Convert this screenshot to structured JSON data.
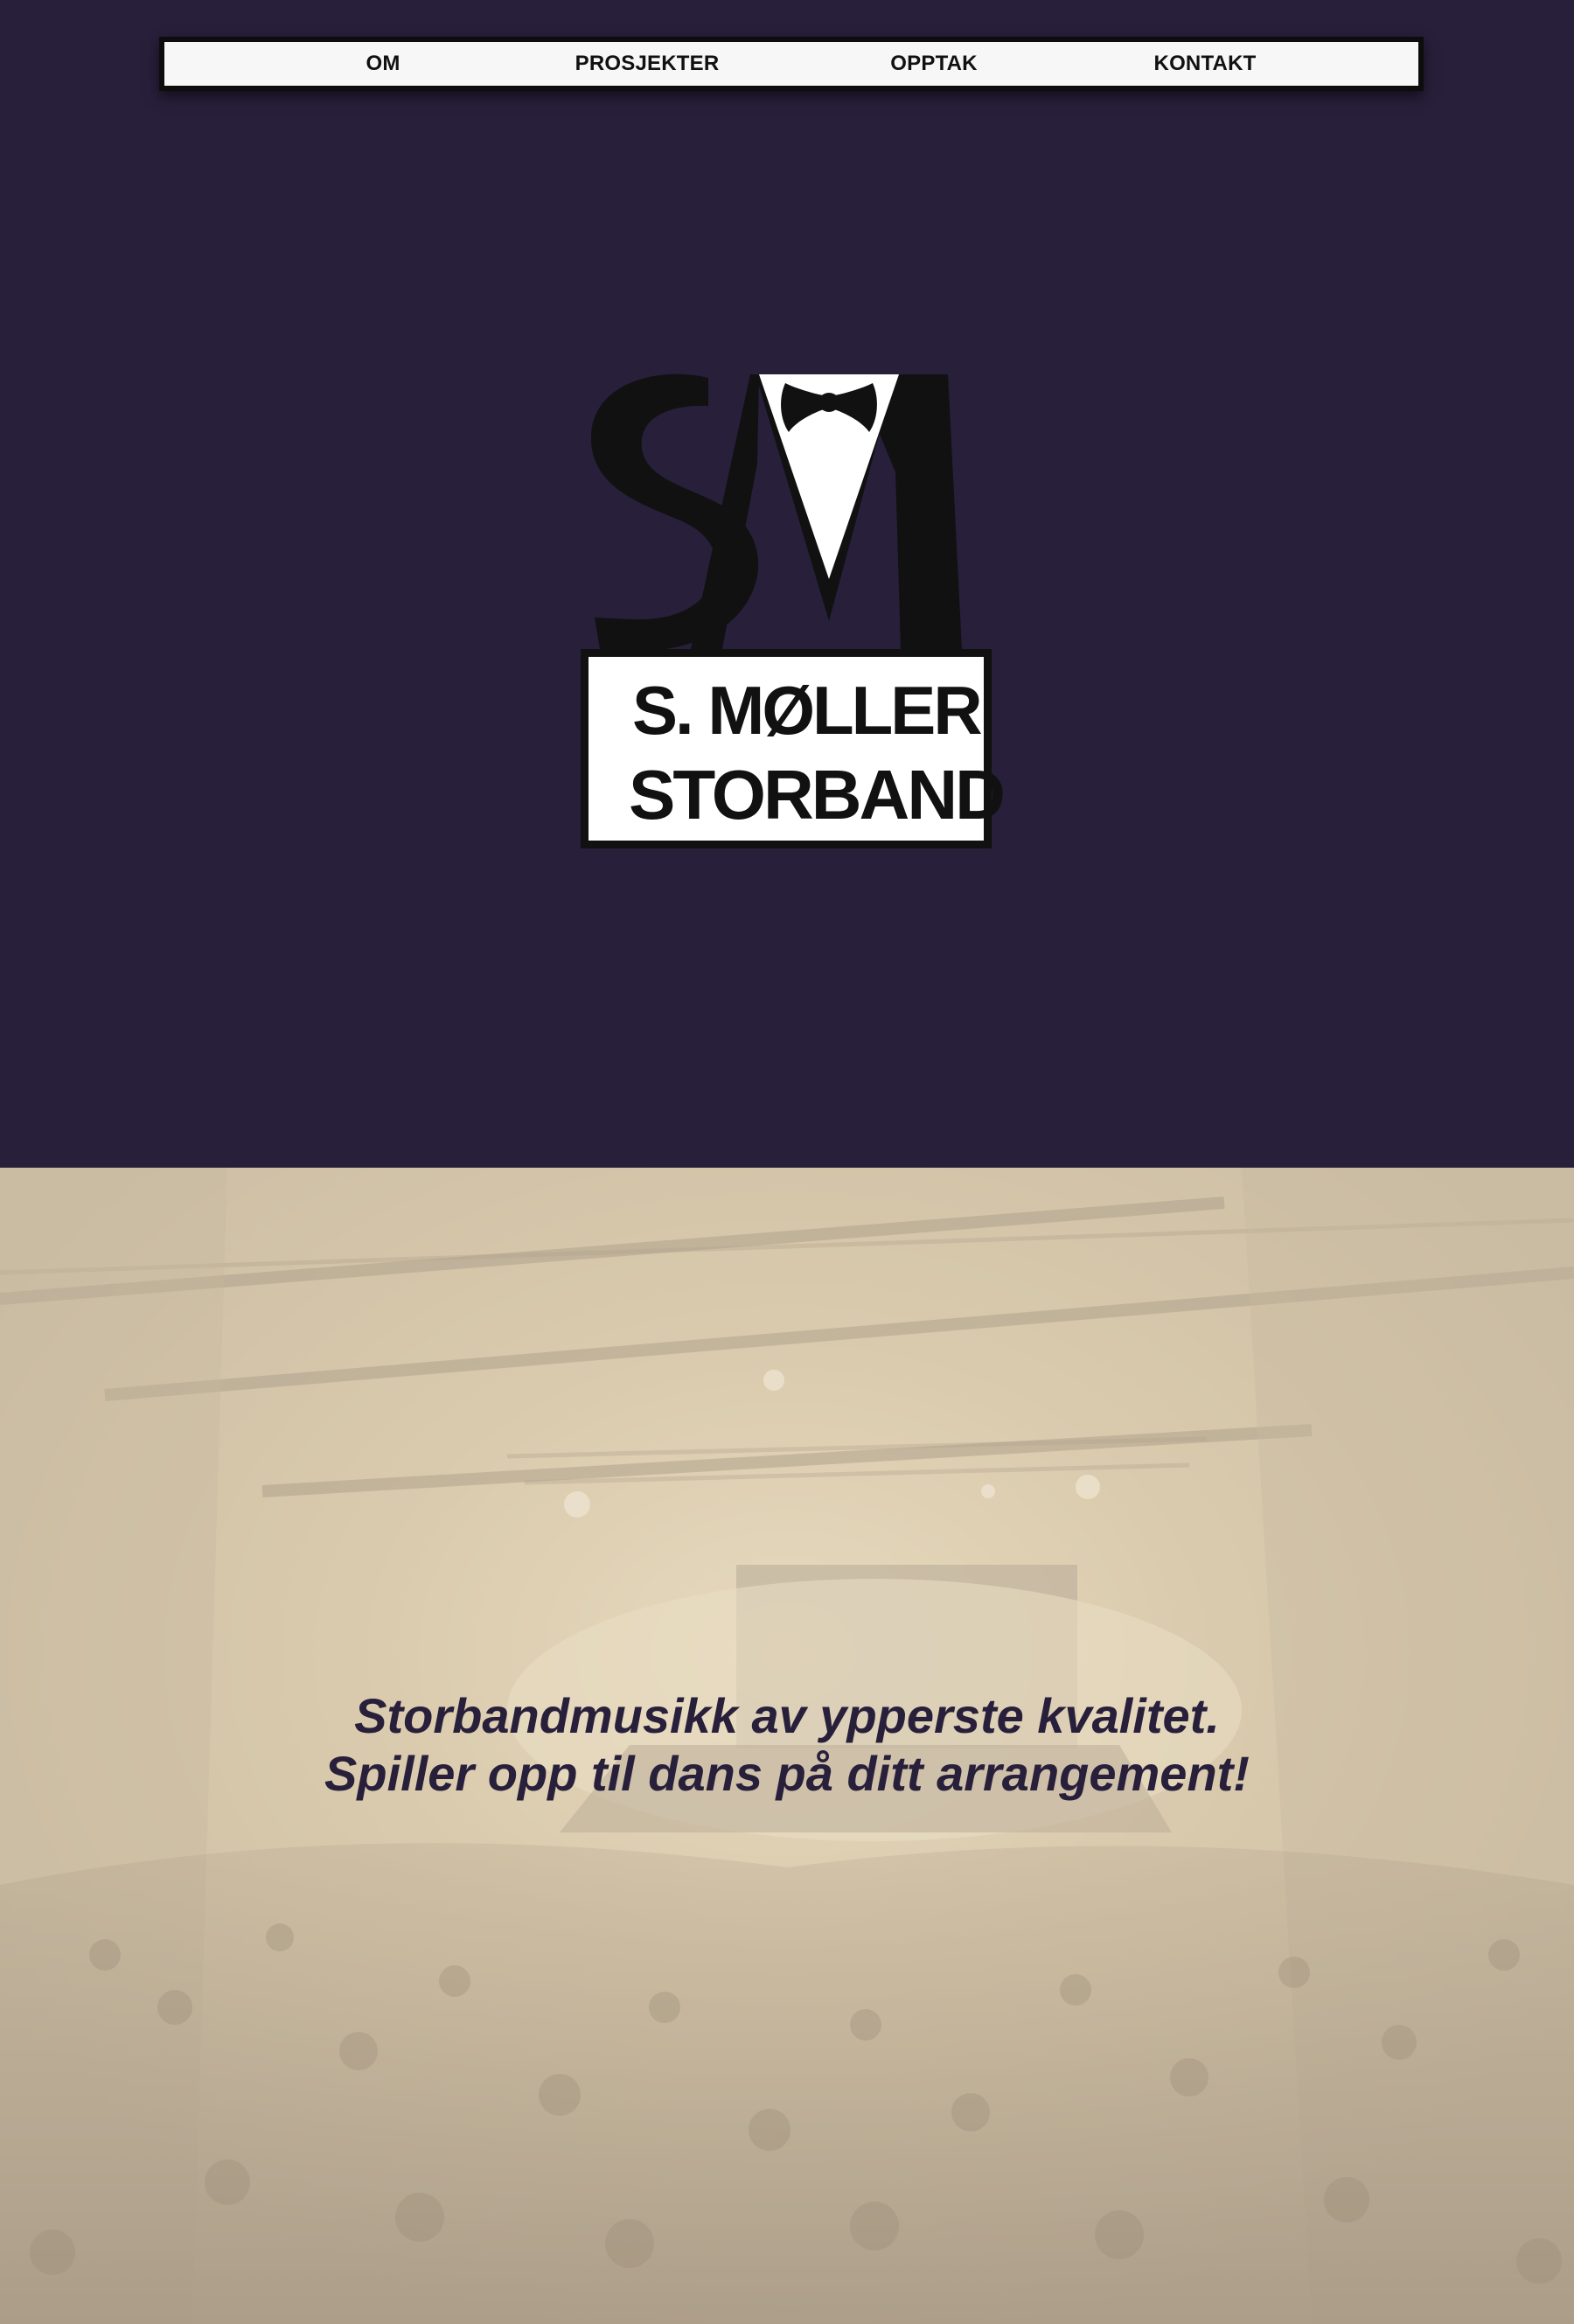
{
  "nav": {
    "items": [
      {
        "label": "OM",
        "name": "nav-item-om"
      },
      {
        "label": "PROSJEKTER",
        "name": "nav-item-prosjekter"
      },
      {
        "label": "OPPTAK",
        "name": "nav-item-opptak"
      },
      {
        "label": "KONTAKT",
        "name": "nav-item-kontakt"
      }
    ]
  },
  "logo": {
    "monogram": "SM",
    "line1": "S. MØLLER",
    "line2": "STORBAND"
  },
  "hero_section": {
    "tagline_line1": "Storbandmusikk av ypperste kvalitet.",
    "tagline_line2": "Spiller opp til dans på ditt arrangement!"
  },
  "colors": {
    "hero_background": "#281f3b",
    "nav_background": "#f7f7f7",
    "accent_text": "#281f3b",
    "photo_tint": "#d6c9b2"
  }
}
